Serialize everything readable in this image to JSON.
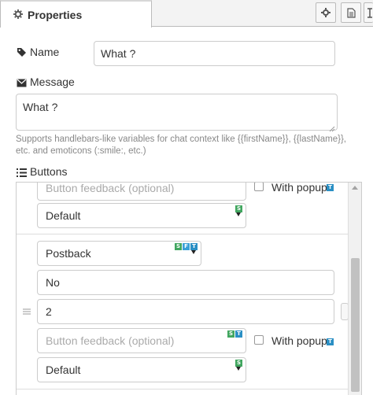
{
  "tabs": {
    "properties_label": "Properties"
  },
  "toolbar": {
    "icons": [
      "gear-icon",
      "document-icon",
      "cursor-icon"
    ]
  },
  "name": {
    "label": "Name",
    "value": "What ?"
  },
  "message": {
    "label": "Message",
    "value": "What ?",
    "help_line1": "Supports handlebars-like variables for chat context like {{firstName}}, {{lastName}},",
    "help_line2": "etc. and emoticons (:smile:, etc.)"
  },
  "buttons": {
    "label": "Buttons",
    "items": [
      {
        "feedback_placeholder": "Button feedback (optional)",
        "with_popup_label": "With popup",
        "style_select": "Default",
        "style_badges": [
          "S"
        ]
      },
      {
        "type_select": "Postback",
        "type_badges": [
          "S",
          "F",
          "T"
        ],
        "label_value": "No",
        "value_value": "2",
        "feedback_placeholder": "Button feedback (optional)",
        "feedback_badges": [
          "S",
          "T"
        ],
        "with_popup_label": "With popup",
        "with_popup_badge": "T",
        "style_select": "Default",
        "style_badges": [
          "S"
        ]
      }
    ]
  },
  "colors": {
    "badge_green": "#41a65f",
    "badge_blue": "#39a0d7",
    "scroll_thumb": "#c1c1c1"
  }
}
